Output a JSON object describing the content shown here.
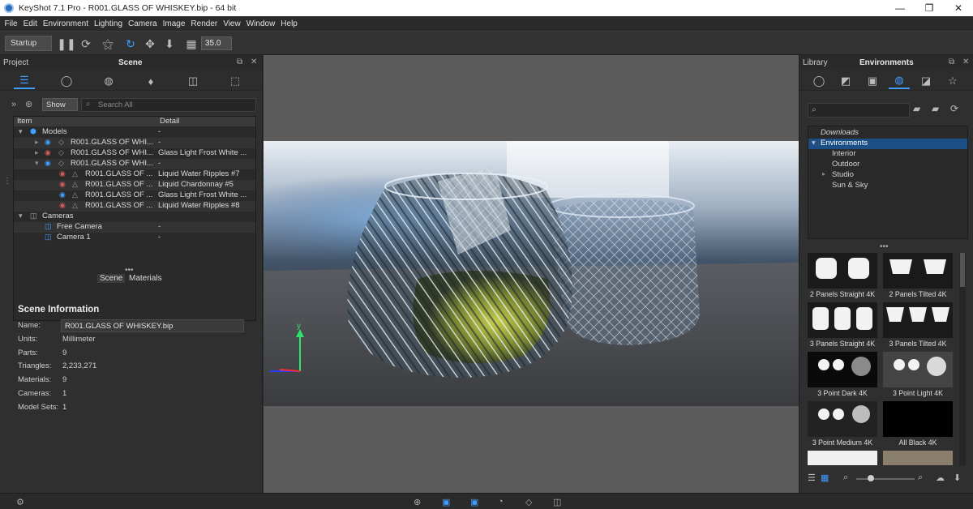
{
  "window": {
    "title": "KeyShot 7.1 Pro  - R001.GLASS OF WHISKEY.bip  - 64 bit",
    "controls": [
      "—",
      "❐",
      "✕"
    ]
  },
  "menu": [
    "File",
    "Edit",
    "Environment",
    "Lighting",
    "Camera",
    "Image",
    "Render",
    "View",
    "Window",
    "Help"
  ],
  "toolbar": {
    "startup_label": "Startup",
    "value": "35.0"
  },
  "left_panel": {
    "tab_left": "Project",
    "title": "Scene",
    "show_label": "Show",
    "search_placeholder": "Search All",
    "columns": {
      "item": "Item",
      "detail": "Detail"
    },
    "tree": [
      {
        "name": "Models",
        "detail": "-"
      },
      {
        "name": "R001.GLASS OF WHI...",
        "detail": "-"
      },
      {
        "name": "R001.GLASS OF WHI...",
        "detail": "Glass Light Frost White ..."
      },
      {
        "name": "R001.GLASS OF WHI...",
        "detail": "-"
      },
      {
        "name": "R001.GLASS OF ...",
        "detail": "Liquid Water Ripples #7"
      },
      {
        "name": "R001.GLASS OF ...",
        "detail": "Liquid Chardonnay #5"
      },
      {
        "name": "R001.GLASS OF ...",
        "detail": "Glass Light Frost White ..."
      },
      {
        "name": "R001.GLASS OF ...",
        "detail": "Liquid Water Ripples #8"
      },
      {
        "name": "Cameras",
        "detail": ""
      },
      {
        "name": "Free Camera",
        "detail": "-"
      },
      {
        "name": "Camera 1",
        "detail": "-"
      }
    ],
    "subtabs": [
      "Scene",
      "Materials"
    ],
    "scene_info": {
      "heading": "Scene Information",
      "name_label": "Name:",
      "name_value": "R001.GLASS OF WHISKEY.bip",
      "rows": [
        {
          "k": "Units:",
          "v": "Millimeter"
        },
        {
          "k": "Parts:",
          "v": "9"
        },
        {
          "k": "Triangles:",
          "v": "2,233,271"
        },
        {
          "k": "Materials:",
          "v": "9"
        },
        {
          "k": "Cameras:",
          "v": "1"
        },
        {
          "k": "Model Sets:",
          "v": "1"
        }
      ]
    }
  },
  "viewport": {
    "axis_label": "y"
  },
  "right_panel": {
    "tab_left": "Library",
    "title": "Environments",
    "tree": [
      {
        "label": "Downloads"
      },
      {
        "label": "Environments"
      },
      {
        "label": "Interior"
      },
      {
        "label": "Outdoor"
      },
      {
        "label": "Studio"
      },
      {
        "label": "Sun & Sky"
      }
    ],
    "thumbnails": [
      {
        "label": "2 Panels Straight 4K"
      },
      {
        "label": "2 Panels Tilted 4K"
      },
      {
        "label": "3 Panels Straight 4K"
      },
      {
        "label": "3 Panels Tilted 4K"
      },
      {
        "label": "3 Point Dark 4K"
      },
      {
        "label": "3 Point Light 4K"
      },
      {
        "label": "3 Point Medium 4K"
      },
      {
        "label": "All Black 4K"
      }
    ]
  },
  "colors": {
    "accent": "#3e9bff",
    "selection": "#1b4f86",
    "panel": "#2f2f2f"
  }
}
